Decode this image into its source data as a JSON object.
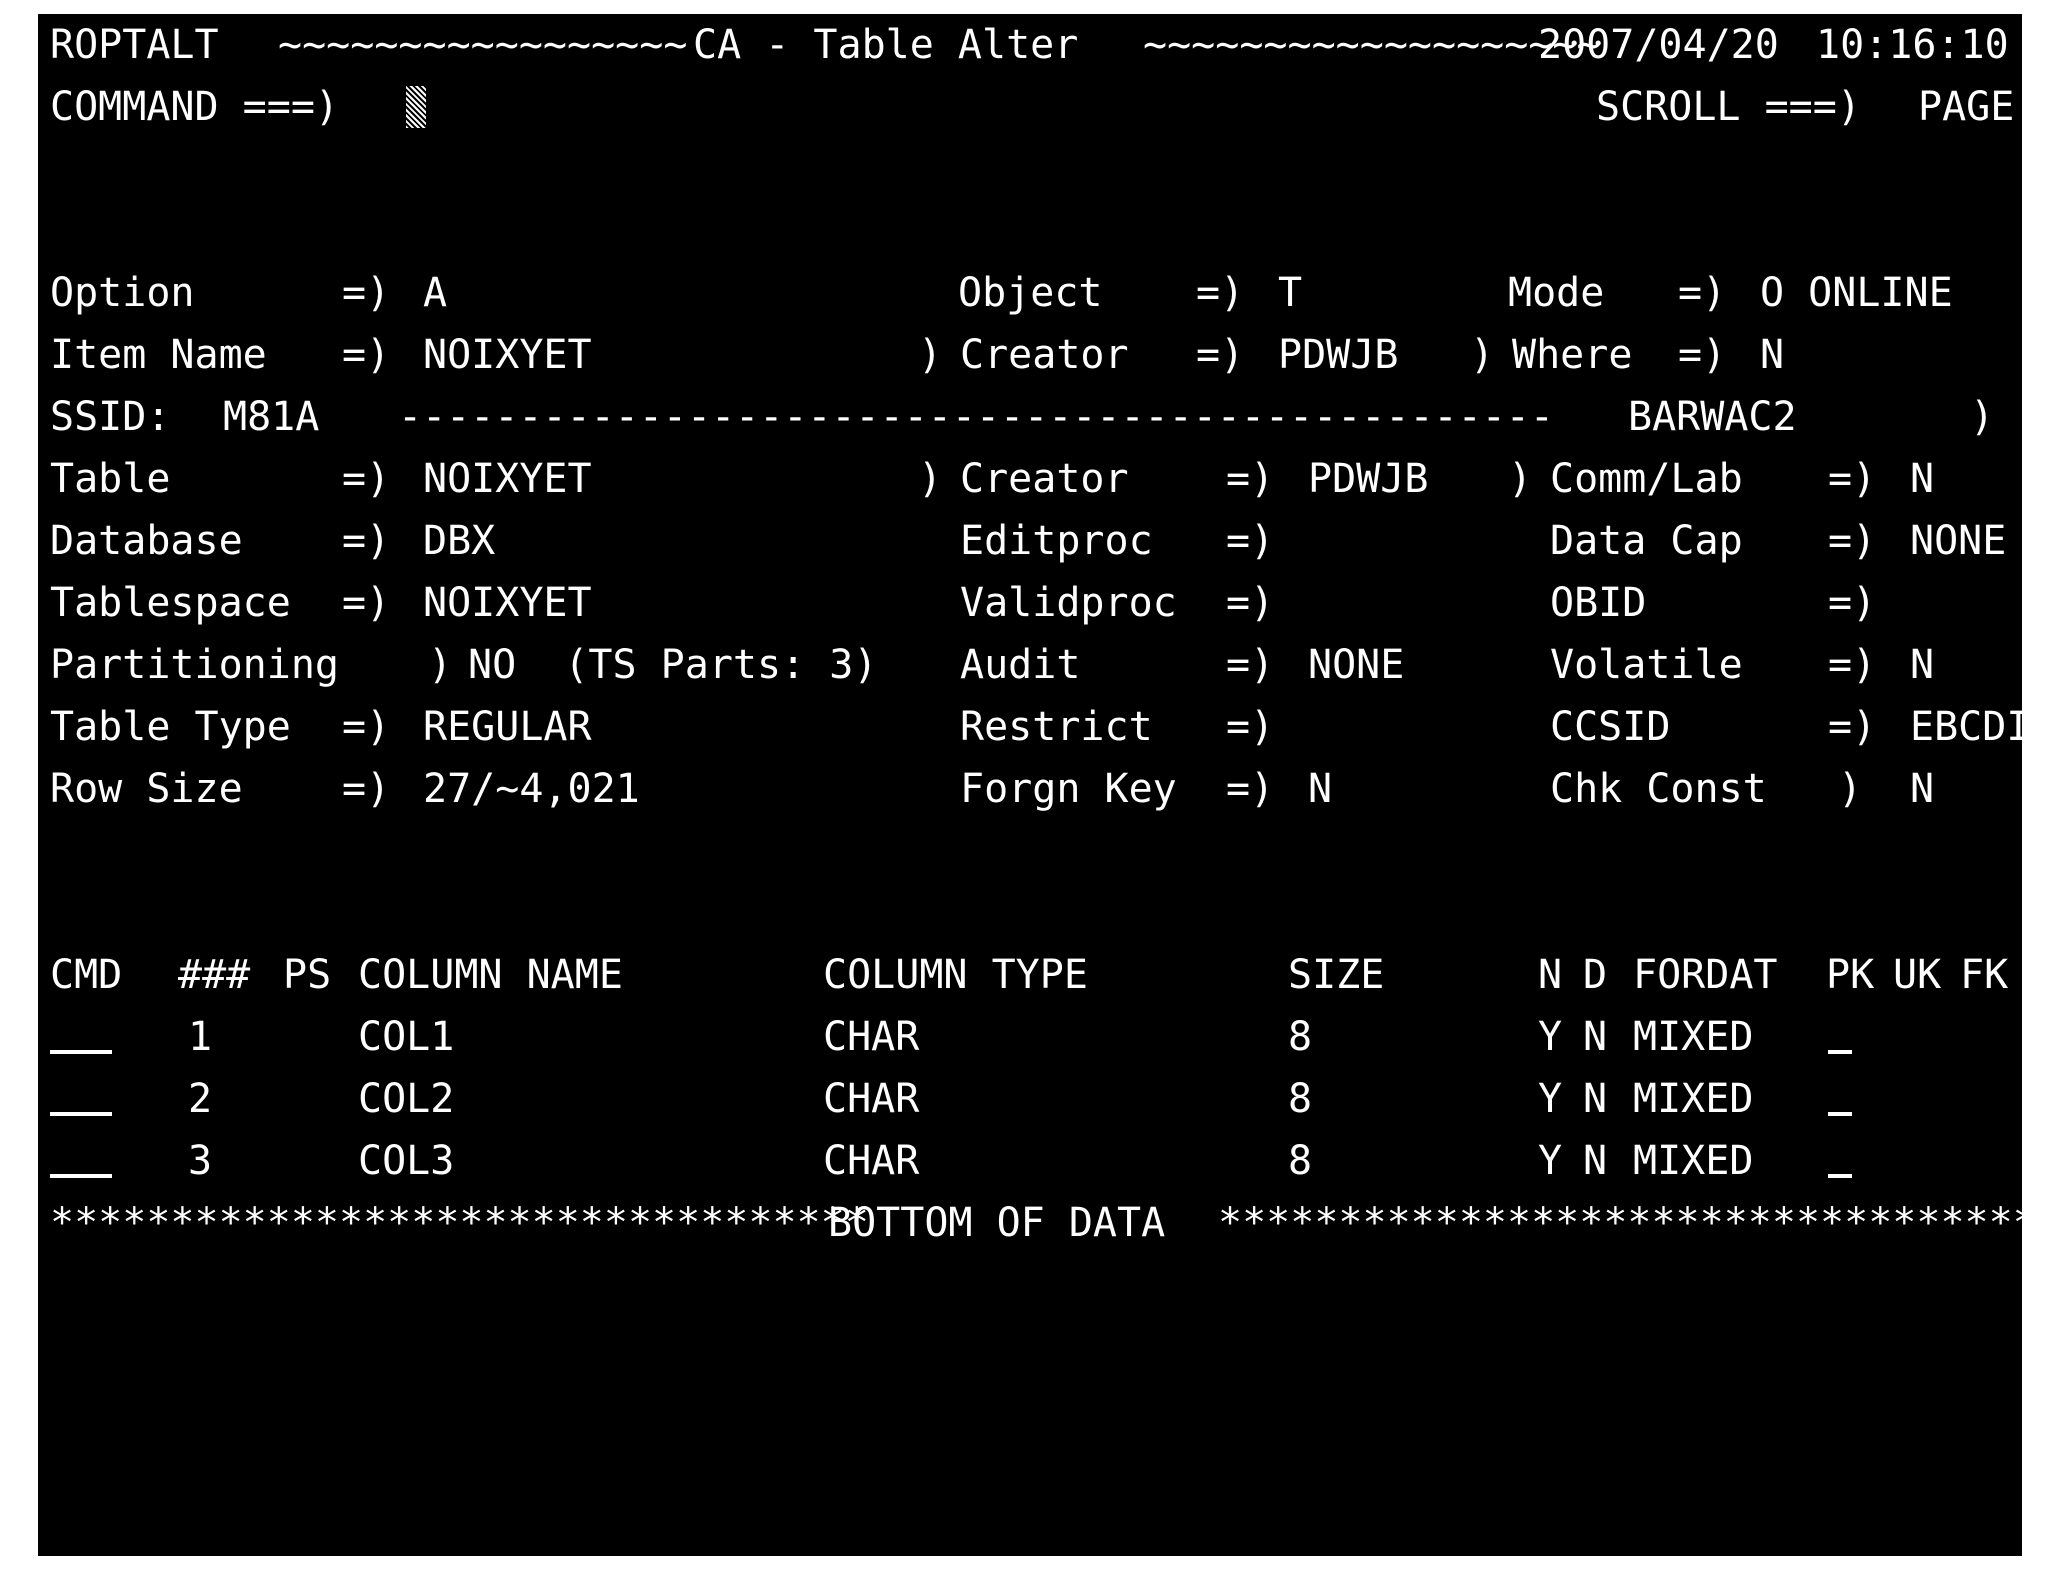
{
  "screen": {
    "background": "#000000",
    "foreground": "#ffffff",
    "page_border": "#ffffff"
  },
  "header": {
    "panel_id": "ROPTALT",
    "left_rule": "~~~~~~~~~~~~~~~~~",
    "title": "CA - Table Alter",
    "right_rule": "~~~~~~~~~~~~~~~~~~~",
    "date": "2007/04/20",
    "time": "10:16:10"
  },
  "command_line": {
    "label": "COMMAND ===)",
    "value": "",
    "cursor": "block-cursor",
    "scroll_label": "SCROLL ===)",
    "scroll_value": "PAGE"
  },
  "selection": {
    "option_label": "Option",
    "option_sep": "=)",
    "option_value": "A",
    "object_label": "Object",
    "object_sep": "=)",
    "object_value": "T",
    "mode_label": "Mode",
    "mode_sep": "=)",
    "mode_value": "O ONLINE",
    "item_name_label": "Item Name",
    "item_name_sep": "=)",
    "item_name_value": "NOIXYET",
    "creator_prompt": ")",
    "creator_label": "Creator",
    "creator_sep": "=)",
    "creator_value": "PDWJB",
    "where_prompt": ")",
    "where_label": "Where",
    "where_sep": "=)",
    "where_value": "N"
  },
  "ssid_bar": {
    "label": "SSID:",
    "value": "M81A",
    "rule": "------------------------------------------------",
    "system": "BARWAC2",
    "more_indicator": ")"
  },
  "attributes": {
    "rows": [
      {
        "left_label": "Table",
        "left_sep": "=)",
        "left_value": "NOIXYET",
        "mid_prompt": ")",
        "mid_label": "Creator",
        "mid_sep": "=)",
        "mid_value": "PDWJB",
        "right_prompt": ")",
        "right_label": "Comm/Lab",
        "right_sep": "=)",
        "right_value": "N"
      },
      {
        "left_label": "Database",
        "left_sep": "=)",
        "left_value": "DBX",
        "mid_prompt": "",
        "mid_label": "Editproc",
        "mid_sep": "=)",
        "mid_value": "",
        "right_prompt": "",
        "right_label": "Data Cap",
        "right_sep": "=)",
        "right_value": "NONE"
      },
      {
        "left_label": "Tablespace",
        "left_sep": "=)",
        "left_value": "NOIXYET",
        "mid_prompt": "",
        "mid_label": "Validproc",
        "mid_sep": "=)",
        "mid_value": "",
        "right_prompt": "",
        "right_label": "OBID",
        "right_sep": "=)",
        "right_value": ""
      },
      {
        "left_label": "Partitioning",
        "left_sep": ")",
        "left_value": "NO  (TS Parts: 3)",
        "mid_prompt": "",
        "mid_label": "Audit",
        "mid_sep": "=)",
        "mid_value": "NONE",
        "right_prompt": "",
        "right_label": "Volatile",
        "right_sep": "=)",
        "right_value": "N"
      },
      {
        "left_label": "Table Type",
        "left_sep": "=)",
        "left_value": "REGULAR",
        "mid_prompt": "",
        "mid_label": "Restrict",
        "mid_sep": "=)",
        "mid_value": "",
        "right_prompt": "",
        "right_label": "CCSID",
        "right_sep": "=)",
        "right_value": "EBCDIC"
      },
      {
        "left_label": "Row Size",
        "left_sep": "=)",
        "left_value": "27/~4,021",
        "mid_prompt": "",
        "mid_label": "Forgn Key",
        "mid_sep": "=)",
        "mid_value": "N",
        "right_prompt": "",
        "right_label": "Chk Const",
        "right_sep": ")",
        "right_value": "N"
      }
    ]
  },
  "column_table": {
    "headers": {
      "cmd": "CMD",
      "num": "###",
      "ps": "PS",
      "column_name": "COLUMN NAME",
      "column_type": "COLUMN TYPE",
      "size": "SIZE",
      "n": "N",
      "d": "D",
      "fordat": "FORDAT",
      "pk": "PK",
      "uk": "UK",
      "fk": "FK"
    },
    "rows": [
      {
        "cmd": "",
        "num": "1",
        "ps": "",
        "column_name": "COL1",
        "column_type": "CHAR",
        "size": "8",
        "n": "Y",
        "d": "N",
        "fordat": "MIXED",
        "pk": "",
        "uk": "",
        "fk": ""
      },
      {
        "cmd": "",
        "num": "2",
        "ps": "",
        "column_name": "COL2",
        "column_type": "CHAR",
        "size": "8",
        "n": "Y",
        "d": "N",
        "fordat": "MIXED",
        "pk": "",
        "uk": "",
        "fk": ""
      },
      {
        "cmd": "",
        "num": "3",
        "ps": "",
        "column_name": "COL3",
        "column_type": "CHAR",
        "size": "8",
        "n": "Y",
        "d": "N",
        "fordat": "MIXED",
        "pk": "",
        "uk": "",
        "fk": ""
      }
    ],
    "bottom_marker": {
      "left_fill": "**********************************",
      "text": "BOTTOM OF DATA",
      "right_fill": "******************************************"
    }
  }
}
